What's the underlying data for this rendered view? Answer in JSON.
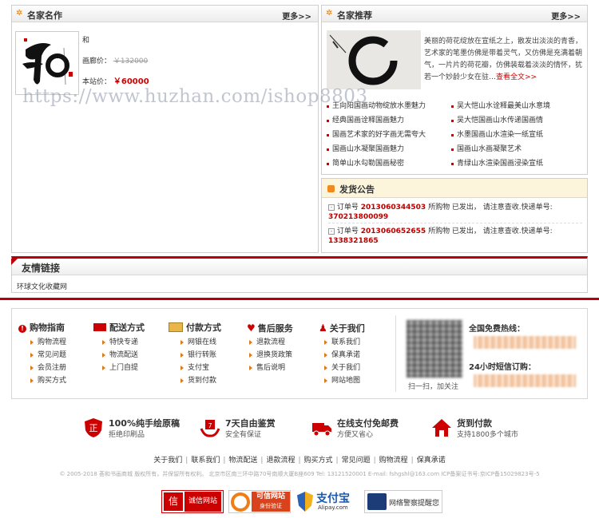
{
  "famous_works": {
    "title": "名家名作",
    "more": "更多>>",
    "product_name": "和",
    "price_label": "画廊价：",
    "price_value": "￥132000",
    "our_price_label": "本站价：",
    "our_price_value": "￥60000"
  },
  "recommend": {
    "title": "名家推荐",
    "more": "更多>>",
    "desc": "美丽的荷花绽放在宣纸之上，散发出淡淡的青香，艺术家的笔墨仿佛是带着灵气，又仿佛是充满着朝气，一片片的荷花瓣，仿佛装载着淡淡的情怀，犹若一个妙龄少女在驻…",
    "view_all": "查看全文>>",
    "links_left": [
      "王向阳国画动物绽放水墨魅力",
      "经典国画诠释国画魅力",
      "国画艺术家的好字画无需夸大",
      "国画山水凝聚国画魅力",
      "简单山水勾勒国画秘密"
    ],
    "links_right": [
      "吴大恺山水诠释最美山水意境",
      "吴大恺国画山水传递国画情",
      "水墨国画山水渲染一纸宣纸",
      "国画山水画凝聚艺术",
      "青绿山水渲染国画浸染宣纸"
    ]
  },
  "shipping": {
    "title": "发货公告",
    "notices": [
      {
        "pre": "订单号",
        "order": "2013060344503",
        "mid": "所购物  已发出，  请注意查收.快递单号:",
        "track": "370213800099"
      },
      {
        "pre": "订单号",
        "order": "2013060652655",
        "mid": "所购物  已发出，  请注意查收.快递单号:",
        "track": "1338321865"
      }
    ]
  },
  "friend_links": {
    "title": "友情链接",
    "items": [
      "环球文化收藏网"
    ]
  },
  "watermark": "https://www.huzhan.com/ishop8803",
  "footer_cols": [
    {
      "title": "购物指南",
      "items": [
        "购物流程",
        "常见问题",
        "会员注册",
        "购买方式"
      ]
    },
    {
      "title": "配送方式",
      "items": [
        "特快专递",
        "物流配送",
        "上门自提"
      ]
    },
    {
      "title": "付款方式",
      "items": [
        "网银在线",
        "银行转账",
        "支付宝",
        "货到付款"
      ]
    },
    {
      "title": "售后服务",
      "items": [
        "退款流程",
        "退换货政策",
        "售后说明"
      ]
    },
    {
      "title": "关于我们",
      "items": [
        "联系我们",
        "保真承诺",
        "关于我们",
        "网站地图"
      ]
    }
  ],
  "qr": {
    "caption": "扫一扫，加关注"
  },
  "hotline": {
    "label": "全国免费热线：",
    "sms_label": "24小时短信订购："
  },
  "features": [
    {
      "title": "100%纯手绘原稿",
      "sub": "拒绝印刷品"
    },
    {
      "title": "7天自由鉴赏",
      "sub": "安全有保证"
    },
    {
      "title": "在线支付免邮费",
      "sub": "方便又省心"
    },
    {
      "title": "货到付款",
      "sub": "支持1800多个城市"
    }
  ],
  "bottom_nav": [
    "关于我们",
    "联系我们",
    "物流配送",
    "退款流程",
    "购买方式",
    "常见问题",
    "购物流程",
    "保真承诺"
  ],
  "copyright": "© 2005-2018 荟和书画商城 版权所有，并保留所有权利。 北京市区南三环中路70号南顺大厦B座609 Tel: 13121520001 E-mail: fshgshl@163.com ICP备案证书号:京ICP备15029823号-5",
  "badges": [
    {
      "text": "诚信网站"
    },
    {
      "text": "可信网站",
      "sub": "身份验证"
    },
    {
      "text": "支付宝",
      "sub": "Alipay.com"
    },
    {
      "text": "网络警察提醒您"
    }
  ],
  "colors": {
    "accent": "#c00000",
    "orange": "#e07a10",
    "border": "#cfcfcf"
  }
}
